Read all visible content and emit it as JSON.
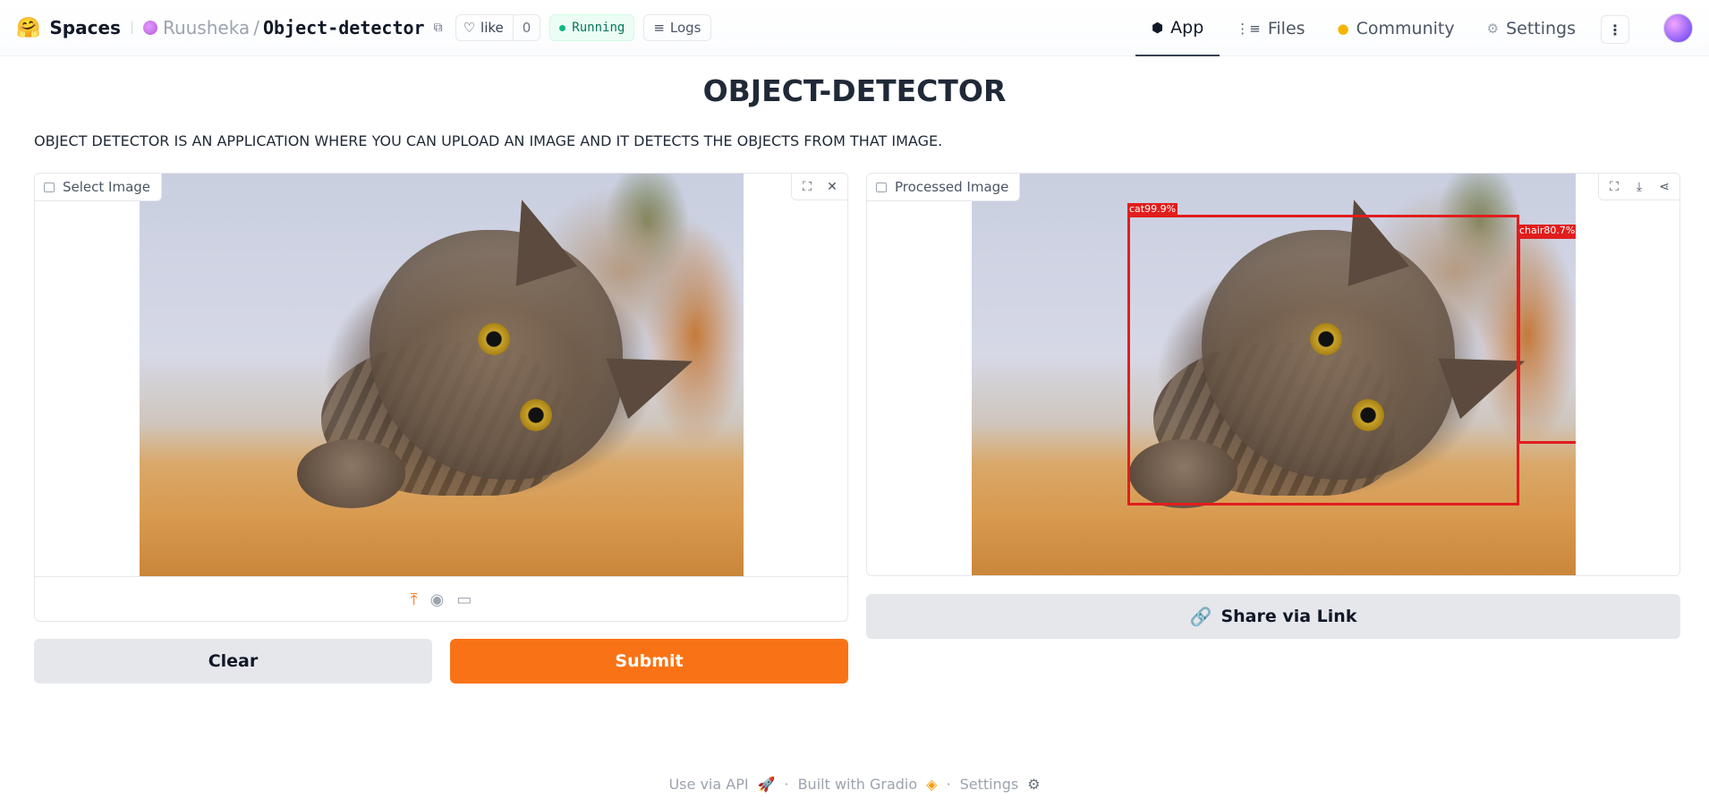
{
  "header": {
    "brand": "Spaces",
    "owner": "Ruusheka",
    "repo": "Object-detector",
    "like_label": "like",
    "like_count": "0",
    "status": "Running",
    "logs_label": "Logs",
    "tabs": [
      {
        "label": "App",
        "icon": "cube-icon",
        "active": true
      },
      {
        "label": "Files",
        "icon": "files-icon",
        "active": false
      },
      {
        "label": "Community",
        "icon": "community-icon",
        "active": false
      },
      {
        "label": "Settings",
        "icon": "gear-icon",
        "active": false
      }
    ]
  },
  "main": {
    "title": "OBJECT-DETECTOR",
    "description": "OBJECT DETECTOR IS AN APPLICATION WHERE YOU CAN UPLOAD AN IMAGE AND IT DETECTS THE OBJECTS FROM THAT IMAGE.",
    "input_panel": {
      "label": "Select Image"
    },
    "output_panel": {
      "label": "Processed Image",
      "detections": [
        {
          "label": "cat99.9%"
        },
        {
          "label": "chair80.7%"
        }
      ]
    },
    "buttons": {
      "clear": "Clear",
      "submit": "Submit",
      "share": "Share via Link"
    }
  },
  "footer": {
    "api": "Use via API",
    "built": "Built with Gradio",
    "settings": "Settings"
  },
  "colors": {
    "accent": "#f97316",
    "running": "#10b981",
    "detection_box": "#e11d1d"
  }
}
